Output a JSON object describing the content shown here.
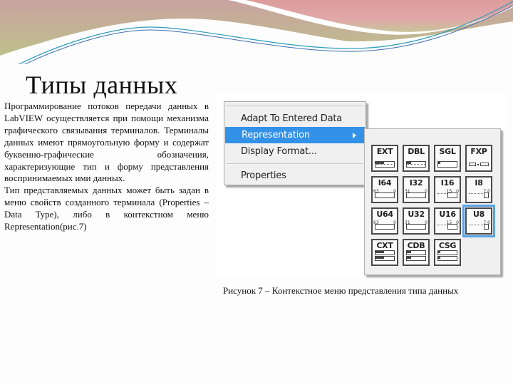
{
  "slide": {
    "title": "Типы данных",
    "paragraphs": [
      "Программирование потоков передачи данных в LabVIEW осуществляется при помощи механизма графического связывания терминалов. Терминалы данных имеют прямоугольную форму и содержат буквенно-графические обозначения, характеризующие тип и форму представления воспринимаемых ими данных.",
      "Тип представляемых данных может быть задан в меню свойств созданного терминала (Properties – Data Type), либо в контекстном меню Representation(рис.7)"
    ],
    "caption": "Рисунок 7 – Контекстное меню представления типа данных"
  },
  "context_menu": {
    "items": [
      {
        "label": "Adapt To Entered Data",
        "active": false
      },
      {
        "label": "Representation",
        "active": true,
        "has_submenu": true
      },
      {
        "label": "Display Format...",
        "active": false
      },
      {
        "label": "Properties",
        "active": false
      }
    ],
    "highlight_color": "#3391e8"
  },
  "representation_submenu": {
    "tiles": [
      {
        "label": "EXT",
        "kind": "float",
        "selected": false
      },
      {
        "label": "DBL",
        "kind": "float",
        "selected": false
      },
      {
        "label": "SGL",
        "kind": "float",
        "selected": false
      },
      {
        "label": "FXP",
        "kind": "fixed",
        "selected": false
      },
      {
        "label": "I64",
        "kind": "int",
        "msb": "63",
        "lsb": "0",
        "selected": false
      },
      {
        "label": "I32",
        "kind": "int",
        "msb": "31",
        "lsb": "0",
        "selected": false
      },
      {
        "label": "I16",
        "kind": "int",
        "msb": "15",
        "lsb": "0",
        "selected": false
      },
      {
        "label": "I8",
        "kind": "int",
        "msb": "7",
        "lsb": "0",
        "selected": false
      },
      {
        "label": "U64",
        "kind": "int",
        "msb": "63",
        "lsb": "0",
        "selected": false
      },
      {
        "label": "U32",
        "kind": "int",
        "msb": "31",
        "lsb": "0",
        "selected": false
      },
      {
        "label": "U16",
        "kind": "int",
        "msb": "15",
        "lsb": "0",
        "selected": false
      },
      {
        "label": "U8",
        "kind": "int",
        "msb": "7",
        "lsb": "0",
        "selected": true
      },
      {
        "label": "CXT",
        "kind": "complex",
        "selected": false
      },
      {
        "label": "CDB",
        "kind": "complex",
        "selected": false
      },
      {
        "label": "CSG",
        "kind": "complex",
        "selected": false
      }
    ],
    "selection_color": "#5aa2e6"
  }
}
